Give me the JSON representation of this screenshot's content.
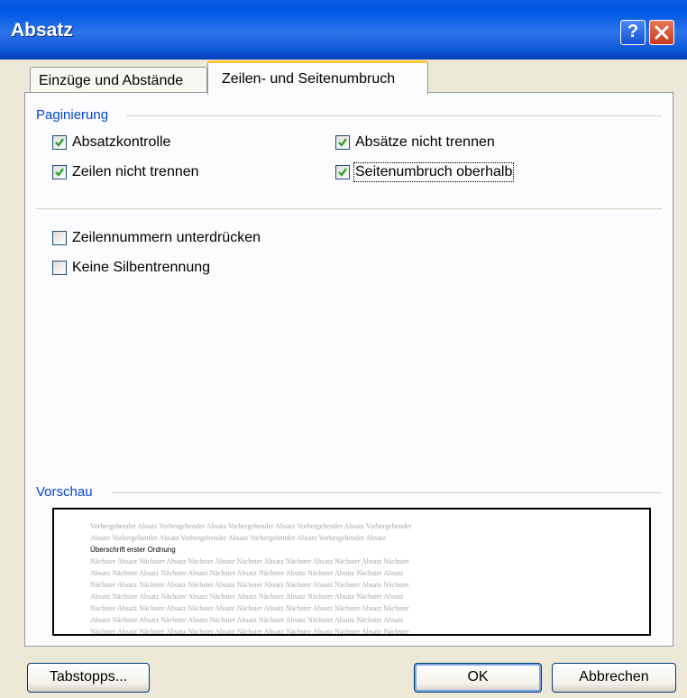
{
  "window": {
    "title": "Absatz"
  },
  "titlebar": {
    "help_label": "?"
  },
  "tabs": [
    {
      "label": "Einzüge und Abstände",
      "active": false
    },
    {
      "label": "Zeilen- und Seitenumbruch",
      "active": true
    }
  ],
  "pagination": {
    "label": "Paginierung",
    "widow_control": {
      "label": "Absatzkontrolle",
      "checked": true
    },
    "keep_lines": {
      "label": "Zeilen nicht trennen",
      "checked": true
    },
    "keep_with_next": {
      "label": "Absätze nicht trennen",
      "checked": true
    },
    "page_break_before": {
      "label": "Seitenumbruch oberhalb",
      "checked": true
    }
  },
  "options": {
    "suppress_line_numbers": {
      "label": "Zeilennummern unterdrücken",
      "checked": false
    },
    "no_hyphenation": {
      "label": "Keine Silbentrennung",
      "checked": false
    }
  },
  "preview": {
    "label": "Vorschau",
    "previous_line1": "Vorhergehender Absatz Vorhergehender Absatz Vorhergehender Absatz Vorhergehender Absatz Vorhergehender",
    "previous_line2": "Absatz Vorhergehender Absatz Vorhergehender Absatz Vorhergehender Absatz Vorhergehender Absatz",
    "current": "Überschrift erster Ordnung",
    "next_line_a": "Nächster Absatz Nächster Absatz Nächster Absatz Nächster Absatz Nächster Absatz Nächster Absatz Nächster",
    "next_line_b": "Absatz Nächster Absatz Nächster Absatz Nächster Absatz Nächster Absatz Nächster Absatz Nächster Absatz"
  },
  "buttons": {
    "tabs": "Tabstopps...",
    "ok": "OK",
    "cancel": "Abbrechen"
  },
  "colors": {
    "titlebar": "#0058E6",
    "group_label": "#0046D5",
    "tab_highlight": "#FFC73C",
    "dialog_bg": "#ECE9D8"
  }
}
